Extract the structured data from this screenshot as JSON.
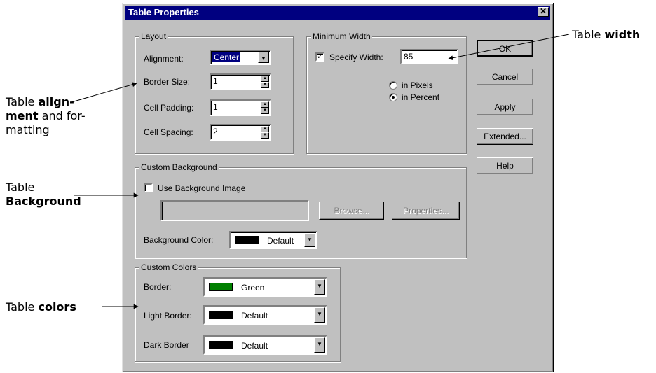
{
  "dialog": {
    "title": "Table Properties",
    "close_glyph": "✕"
  },
  "layout": {
    "group_label": "Layout",
    "alignment_label": "Alignment:",
    "alignment_value": "Center",
    "border_size_label": "Border Size:",
    "border_size_value": "1",
    "cell_padding_label": "Cell Padding:",
    "cell_padding_value": "1",
    "cell_spacing_label": "Cell Spacing:",
    "cell_spacing_value": "2"
  },
  "min_width": {
    "group_label": "Minimum Width",
    "specify_label": "Specify Width:",
    "specify_checked": true,
    "width_value": "85",
    "pixels_label": "in Pixels",
    "percent_label": "in Percent",
    "selected": "in Percent"
  },
  "background": {
    "group_label": "Custom Background",
    "use_image_label": "Use Background Image",
    "use_image_checked": false,
    "image_path_value": "",
    "browse_label": "Browse...",
    "properties_label": "Properties...",
    "color_label": "Background Color:",
    "color_value": "Default",
    "color_swatch": "#000000"
  },
  "colors": {
    "group_label": "Custom Colors",
    "border_label": "Border:",
    "border_value": "Green",
    "border_swatch": "#008000",
    "light_label": "Light Border:",
    "light_value": "Default",
    "light_swatch": "#000000",
    "dark_label": "Dark Border",
    "dark_value": "Default",
    "dark_swatch": "#000000"
  },
  "buttons": {
    "ok": "OK",
    "cancel": "Cancel",
    "apply": "Apply",
    "extended": "Extended...",
    "help": "Help"
  },
  "annotations": {
    "width_prefix": "Table ",
    "width_bold": "width",
    "align_line1_prefix": "Table ",
    "align_line1_bold": "align-",
    "align_line2_bold": "ment",
    "align_line2_rest": " and for-",
    "align_line3": "matting",
    "bg_line1": "Table",
    "bg_line2_bold": "Background",
    "colors_prefix": "Table ",
    "colors_bold": "colors"
  },
  "theme": {
    "face": "#c0c0c0",
    "title_bar": "#000080",
    "highlight": "#000080"
  }
}
